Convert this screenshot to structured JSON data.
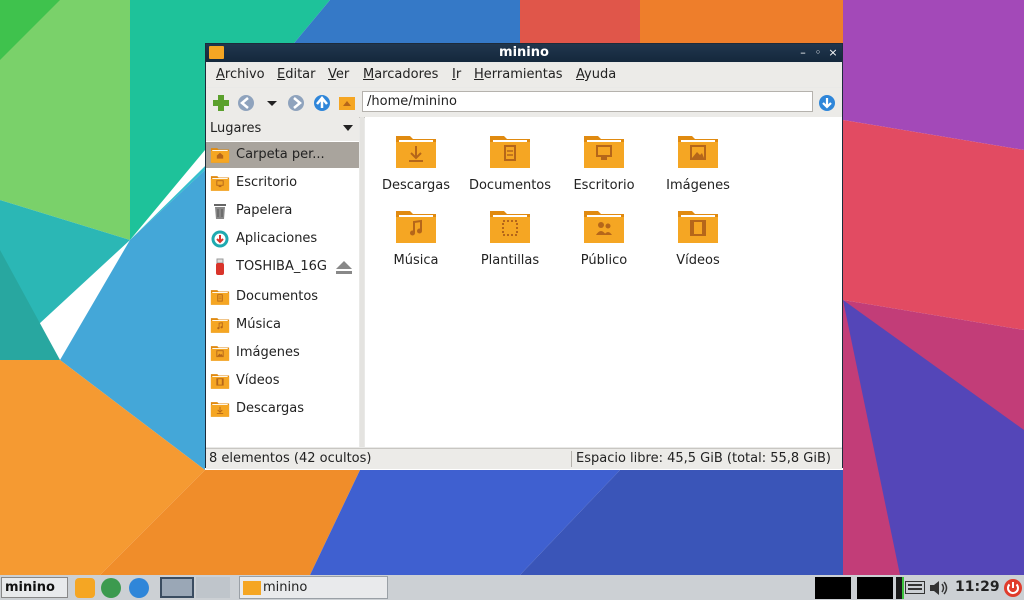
{
  "window": {
    "title": "minino",
    "buttons": [
      "–",
      "◦",
      "×"
    ]
  },
  "menubar": [
    "Archivo",
    "Editar",
    "Ver",
    "Marcadores",
    "Ir",
    "Herramientas",
    "Ayuda"
  ],
  "toolbar": {
    "buttons": [
      "new-folder-icon",
      "back-icon",
      "history-dropdown-icon",
      "forward-icon",
      "up-icon",
      "home-icon"
    ],
    "location": "/home/minino",
    "go_icon": "go-icon"
  },
  "sidebar": {
    "header": "Lugares",
    "items": [
      {
        "label": "Carpeta per...",
        "icon": "home-folder-icon",
        "selected": true
      },
      {
        "label": "Escritorio",
        "icon": "desktop-folder-icon"
      },
      {
        "label": "Papelera",
        "icon": "trash-icon"
      },
      {
        "label": "Aplicaciones",
        "icon": "applications-icon"
      },
      {
        "label": "TOSHIBA_16G",
        "icon": "usb-drive-icon",
        "eject": "eject-icon"
      },
      {
        "label": "Documentos",
        "icon": "documents-folder-icon"
      },
      {
        "label": "Música",
        "icon": "music-folder-icon"
      },
      {
        "label": "Imágenes",
        "icon": "pictures-folder-icon"
      },
      {
        "label": "Vídeos",
        "icon": "videos-folder-icon"
      },
      {
        "label": "Descargas",
        "icon": "downloads-folder-icon"
      }
    ]
  },
  "files": [
    {
      "label": "Descargas",
      "icon": "downloads-folder-icon"
    },
    {
      "label": "Documentos",
      "icon": "documents-folder-icon"
    },
    {
      "label": "Escritorio",
      "icon": "desktop-folder-icon"
    },
    {
      "label": "Imágenes",
      "icon": "pictures-folder-icon"
    },
    {
      "label": "Música",
      "icon": "music-folder-icon"
    },
    {
      "label": "Plantillas",
      "icon": "templates-folder-icon"
    },
    {
      "label": "Público",
      "icon": "public-folder-icon"
    },
    {
      "label": "Vídeos",
      "icon": "videos-folder-icon"
    }
  ],
  "status": {
    "left": "8 elementos (42 ocultos)",
    "right": "Espacio libre: 45,5 GiB (total: 55,8 GiB)"
  },
  "taskbar": {
    "menu_label": "minino",
    "task_label": "minino",
    "clock": "11:29"
  },
  "colors": {
    "folder": "#f5a623",
    "folder_dark": "#e08a10",
    "titlebar": "#1b2f44",
    "selection": "#a9a49d"
  }
}
